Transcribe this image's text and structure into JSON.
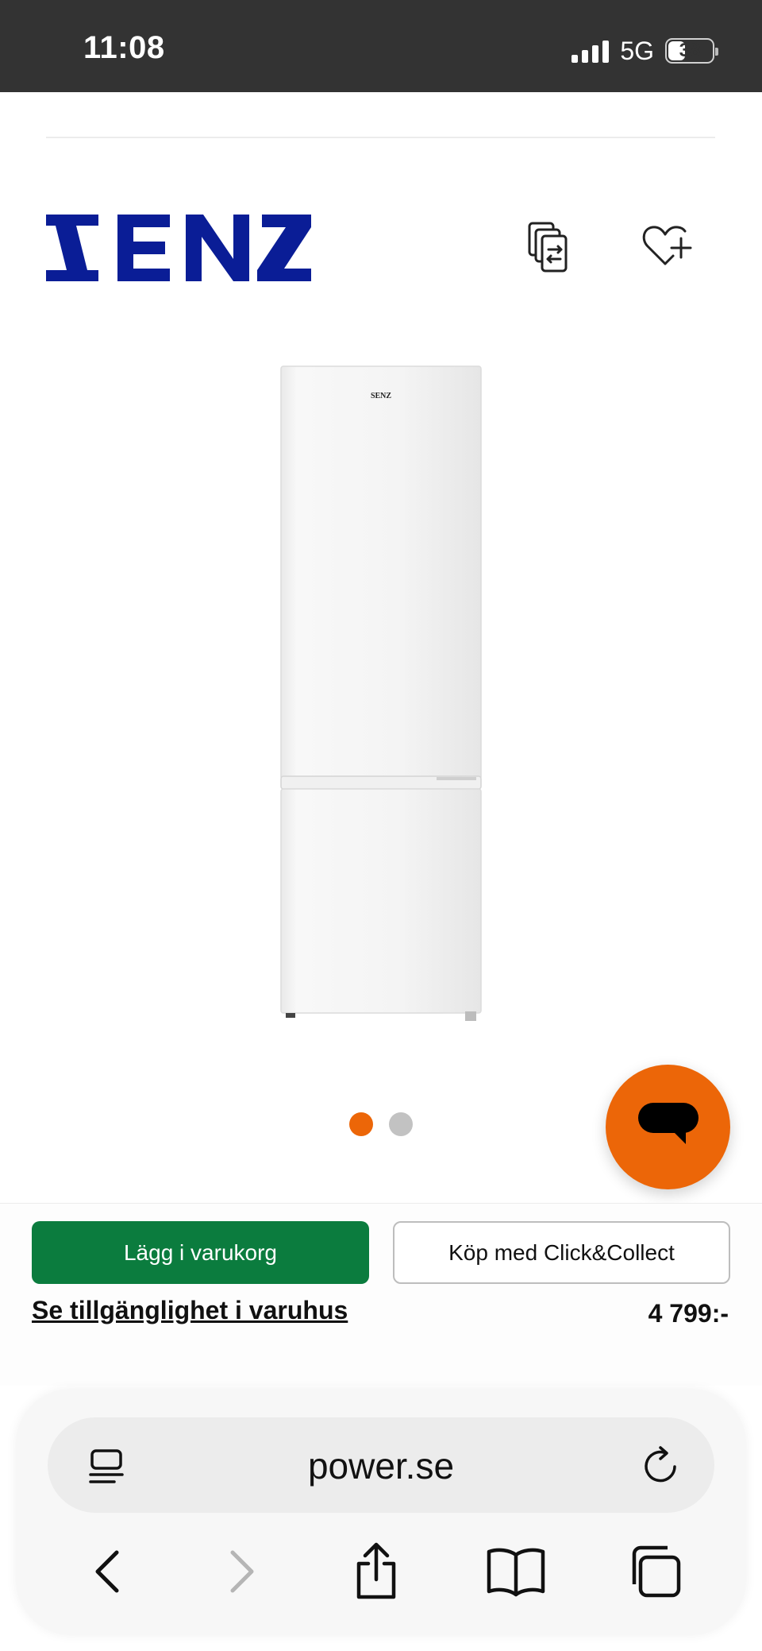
{
  "status_bar": {
    "time": "11:08",
    "network": "5G",
    "battery": "38"
  },
  "brand": {
    "name": "SENZ",
    "color": "#0a1d96"
  },
  "product": {
    "image_icon": "fridge-freezer-image",
    "logo_text": "SENZ"
  },
  "carousel": {
    "active_index": 0,
    "count": 2,
    "active_color": "#ec6608",
    "inactive_color": "#c2c2c2"
  },
  "chat": {
    "icon": "chat-bubble-icon",
    "color": "#ec6608"
  },
  "actions": {
    "add_to_cart_label": "Lägg i varukorg",
    "add_to_cart_color": "#0b7c3e",
    "click_collect_label": "Köp med Click&Collect",
    "store_availability_label": "Se tillgänglighet i varuhus",
    "price": "4 799:-"
  },
  "browser": {
    "url": "power.se",
    "reader_icon": "page-menu-icon",
    "reload_icon": "reload-icon",
    "nav": [
      "back-icon",
      "forward-icon",
      "share-icon",
      "bookmarks-icon",
      "tabs-icon"
    ]
  }
}
